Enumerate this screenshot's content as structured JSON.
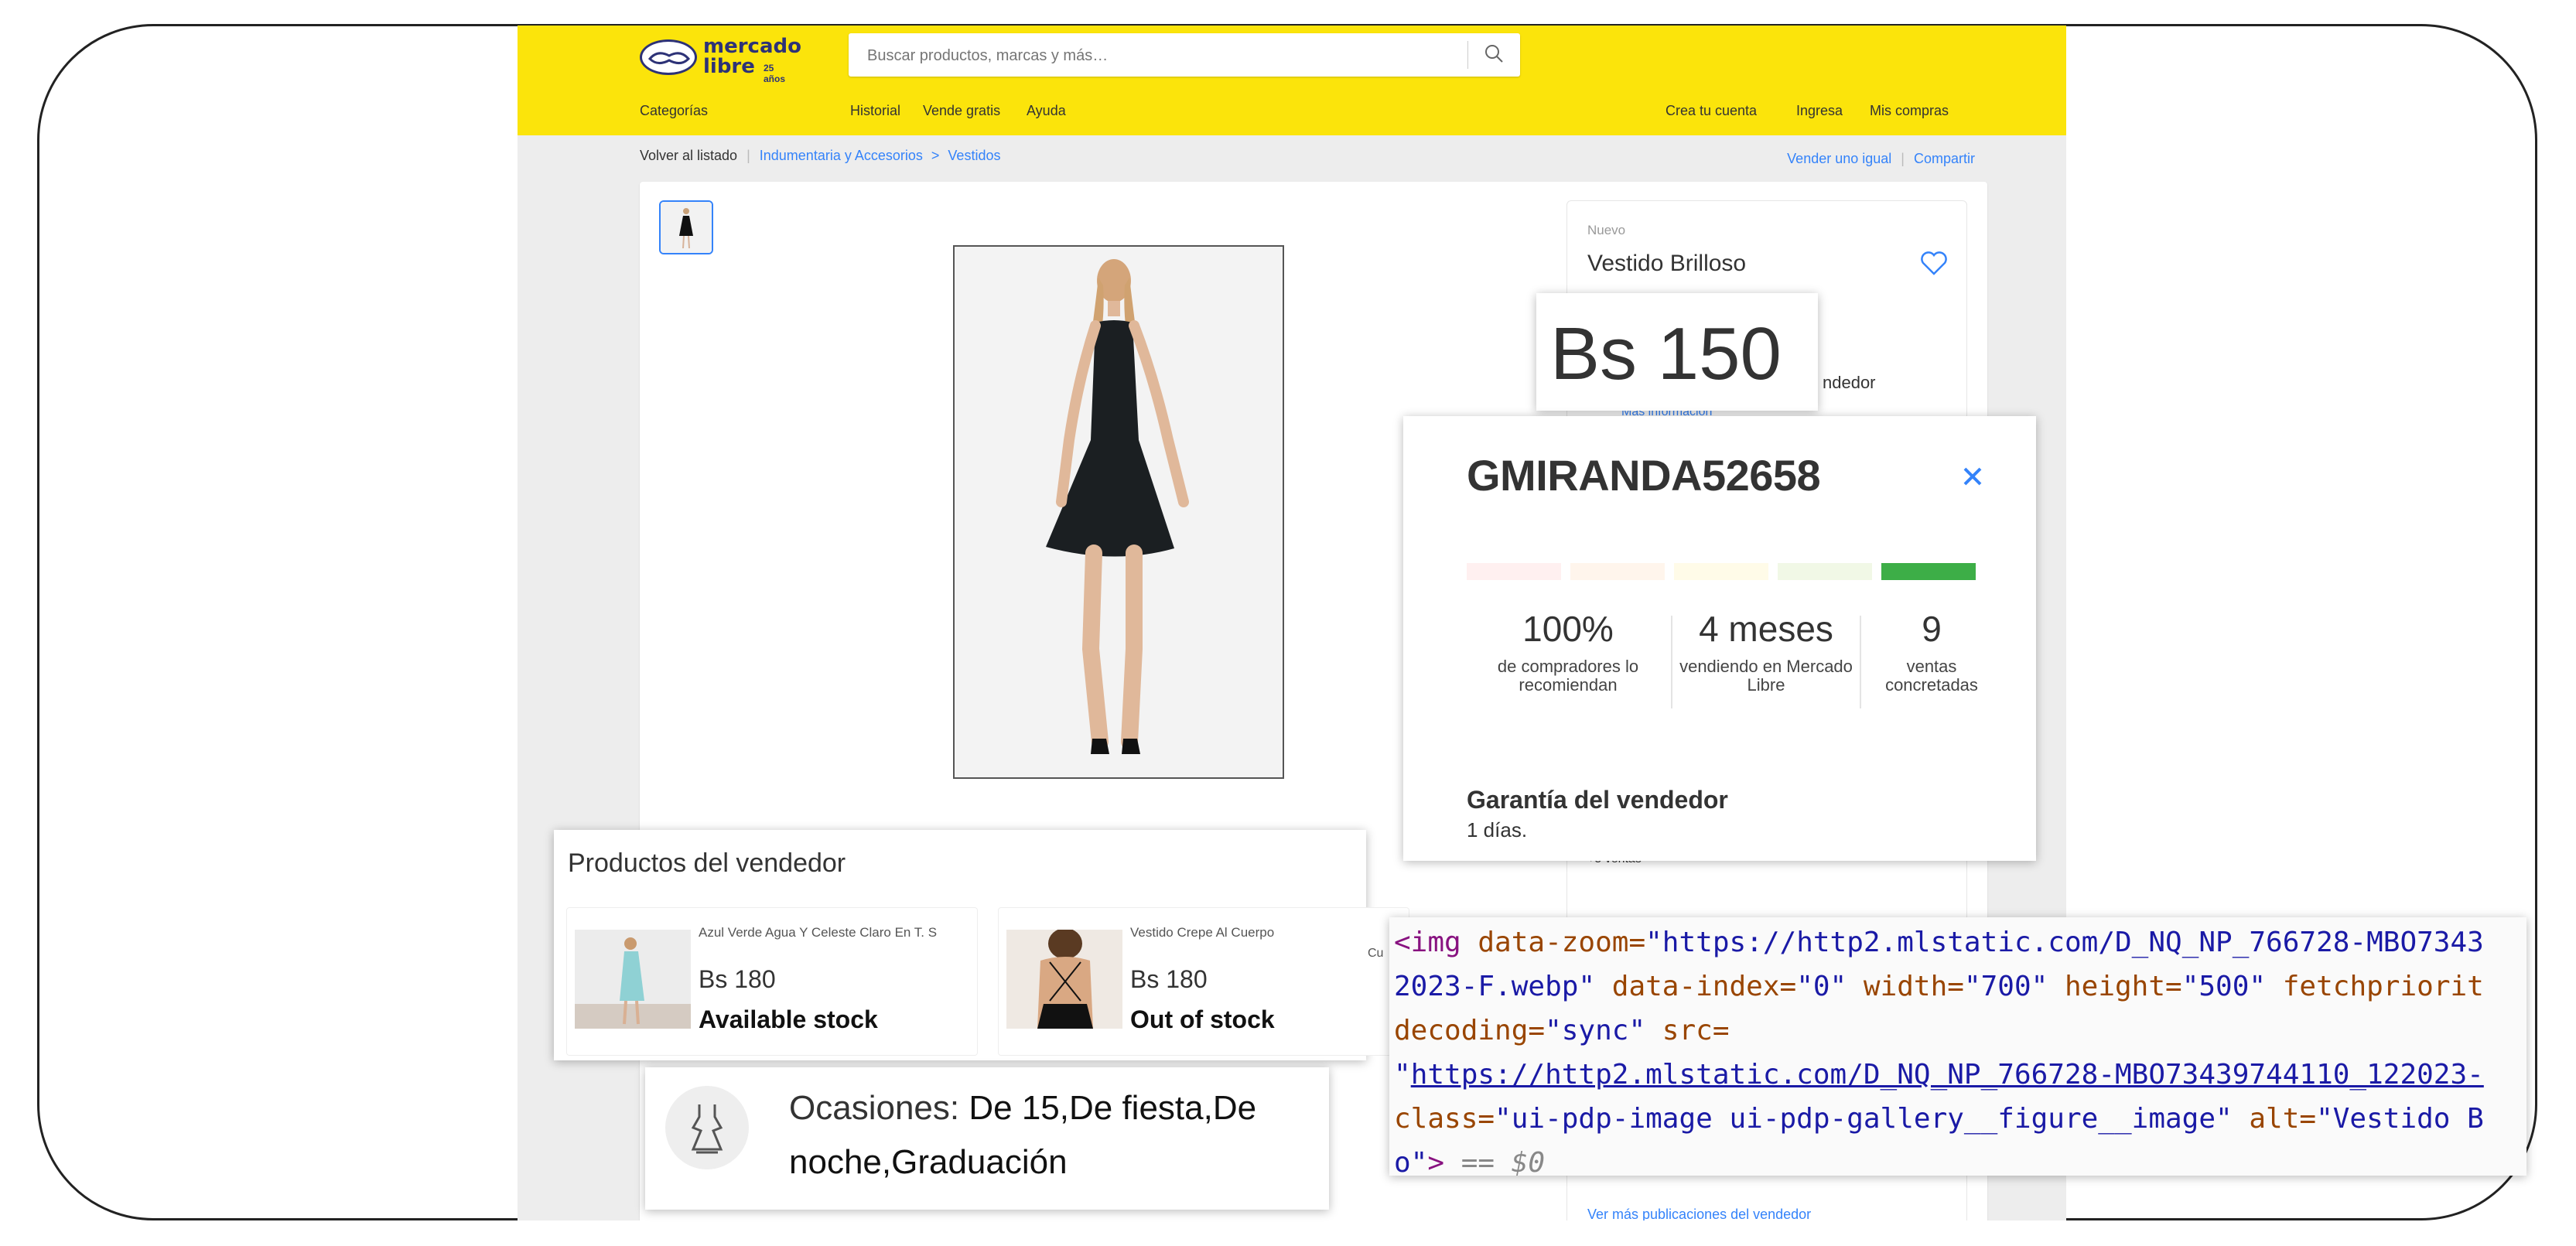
{
  "header": {
    "logo_text": "mercado libre",
    "logo_word1": "mercado",
    "logo_word2": "libre",
    "logo_years": "25 años",
    "search_placeholder": "Buscar productos, marcas y más…",
    "nav_left": [
      "Categorías",
      "Historial",
      "Vende gratis",
      "Ayuda"
    ],
    "nav_right": [
      "Crea tu cuenta",
      "Ingresa",
      "Mis compras"
    ],
    "brand_color": "#fbe40b"
  },
  "breadcrumb": {
    "back": "Volver al listado",
    "path": [
      "Indumentaria y Accesorios",
      "Vestidos"
    ],
    "separator": ">",
    "right": [
      "Vender uno igual",
      "Compartir"
    ]
  },
  "product": {
    "condition": "Nuevo",
    "title": "Vestido Brilloso",
    "price": "Bs 150",
    "seller_fragment": "ndedor",
    "more_info": "Más información",
    "sales": "+5 ventas",
    "more_listings": "Ver más publicaciones del vendedor"
  },
  "seller_card": {
    "name": "GMIRANDA52658",
    "reputation_colors": [
      "#fff0f0",
      "#fff5ec",
      "#fffbe8",
      "#f1f8e6",
      "#3dae47"
    ],
    "reputation_level": 5,
    "stats": [
      {
        "value": "100%",
        "label": "de compradores lo recomiendan"
      },
      {
        "value": "4 meses",
        "label": "vendiendo en Mercado Libre"
      },
      {
        "value": "9",
        "label": "ventas concretadas"
      }
    ],
    "guarantee_title": "Garantía del vendedor",
    "guarantee_value": "1 días."
  },
  "seller_products": {
    "title": "Productos del vendedor",
    "items": [
      {
        "name": "Azul Verde Agua Y Celeste Claro En T. S",
        "price": "Bs 180",
        "stock": "Available stock"
      },
      {
        "name": "Vestido Crepe Al Cuerpo",
        "price": "Bs 180",
        "stock": "Out of stock"
      }
    ],
    "cut_text": "Cu"
  },
  "occasions": {
    "label": "Ocasiones: ",
    "value": "De 15,De fiesta,De noche,Graduación"
  },
  "code_snippet": {
    "line1": {
      "tag": "<img",
      "attr": " data-zoom=",
      "str": "\"https://http2.mlstatic.com/D_NQ_NP_766728-MBO7343"
    },
    "line2": {
      "str1": "2023-F.webp\"",
      "attr1": " data-index=",
      "str2": "\"0\"",
      "attr2": " width=",
      "str3": "\"700\"",
      "attr3": " height=",
      "str4": "\"500\"",
      "attr4": " fetchpriorit"
    },
    "line3": {
      "attr1": "decoding=",
      "str1": "\"sync\"",
      "attr2": " src="
    },
    "line4": {
      "q": "\"",
      "link": "https://http2.mlstatic.com/D_NQ_NP_766728-MBO73439744110_122023-"
    },
    "line5": {
      "attr1": "class=",
      "str1": "\"ui-pdp-image ui-pdp-gallery__figure__image\"",
      "attr2": " alt=",
      "str2": "\"Vestido B"
    },
    "line6": {
      "str": "o\"",
      "tag": ">",
      "dim": " == $0"
    }
  }
}
